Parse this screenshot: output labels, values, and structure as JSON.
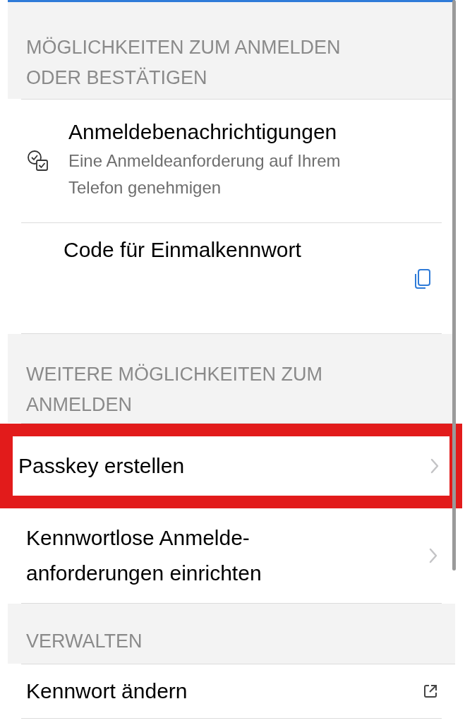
{
  "sections": [
    {
      "header": "MÖGLICHKEITEN ZUM ANMELDEN ODER BESTÄTIGEN",
      "items": [
        {
          "kind": "notification",
          "title": "Anmeldebenachrichtigungen",
          "subtitle": "Eine Anmeldeanforderung auf Ihrem Telefon genehmigen",
          "highlighted": false
        },
        {
          "kind": "code",
          "title": "Code für Einmalkennwort",
          "highlighted": false
        }
      ]
    },
    {
      "header": "WEITERE MÖGLICHKEITEN ZUM ANMELDEN",
      "items": [
        {
          "kind": "nav",
          "title": "Passkey erstellen",
          "highlighted": true
        },
        {
          "kind": "nav",
          "title": "Kennwortlose Anmelde-anforderungen einrichten",
          "highlighted": false
        }
      ]
    },
    {
      "header": "VERWALTEN",
      "items": [
        {
          "kind": "external",
          "title": "Kennwort ändern",
          "highlighted": false
        }
      ]
    }
  ]
}
